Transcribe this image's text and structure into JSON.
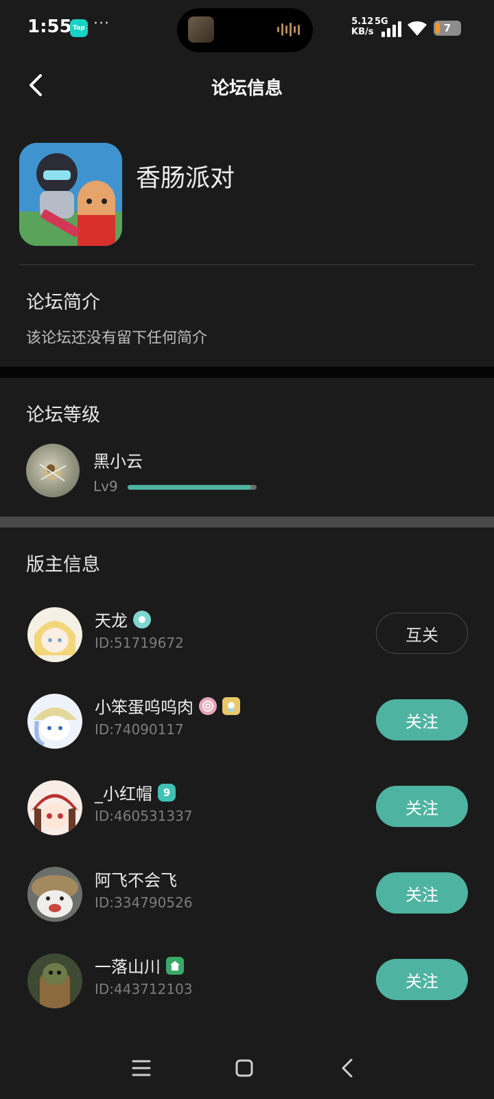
{
  "status_bar": {
    "time": "1:55",
    "tap_badge": "Tap",
    "overflow_dots": "···",
    "net_speed_value": "5.12",
    "net_speed_unit": "KB/s",
    "network_type": "5G",
    "battery_level": "7"
  },
  "header": {
    "title": "论坛信息"
  },
  "forum": {
    "name": "香肠派对"
  },
  "intro": {
    "title": "论坛简介",
    "text": "该论坛还没有留下任何简介"
  },
  "level": {
    "title": "论坛等级",
    "user_name": "黑小云",
    "level_label": "Lv9",
    "progress": 0.96,
    "progress_color": "#4fb3a1"
  },
  "moderators": {
    "title": "版主信息",
    "items": [
      {
        "name": "天龙",
        "id_text": "ID:51719672",
        "action": "互关",
        "action_type": "mutual",
        "badges": [
          {
            "icon": "planet-badge-icon",
            "color": "#7fd6d0"
          }
        ]
      },
      {
        "name": "小笨蛋呜呜肉",
        "id_text": "ID:74090117",
        "action": "关注",
        "action_type": "follow",
        "badges": [
          {
            "icon": "spiral-candy-badge-icon",
            "color": "#e7a5b6"
          },
          {
            "icon": "character-badge-icon",
            "color": "#e9c86a"
          }
        ]
      },
      {
        "name": "_小红帽",
        "id_text": "ID:460531337",
        "action": "关注",
        "action_type": "follow",
        "badges": [
          {
            "icon": "level-nine-badge-icon",
            "color": "#3fc1b5",
            "text": "9"
          }
        ]
      },
      {
        "name": "阿飞不会飞",
        "id_text": "ID:334790526",
        "action": "关注",
        "action_type": "follow",
        "badges": []
      },
      {
        "name": "一落山川",
        "id_text": "ID:443712103",
        "action": "关注",
        "action_type": "follow",
        "badges": [
          {
            "icon": "house-badge-icon",
            "color": "#3aa86a"
          }
        ]
      }
    ]
  },
  "colors": {
    "accent": "#4fb3a1",
    "background": "#1b1b1b"
  }
}
